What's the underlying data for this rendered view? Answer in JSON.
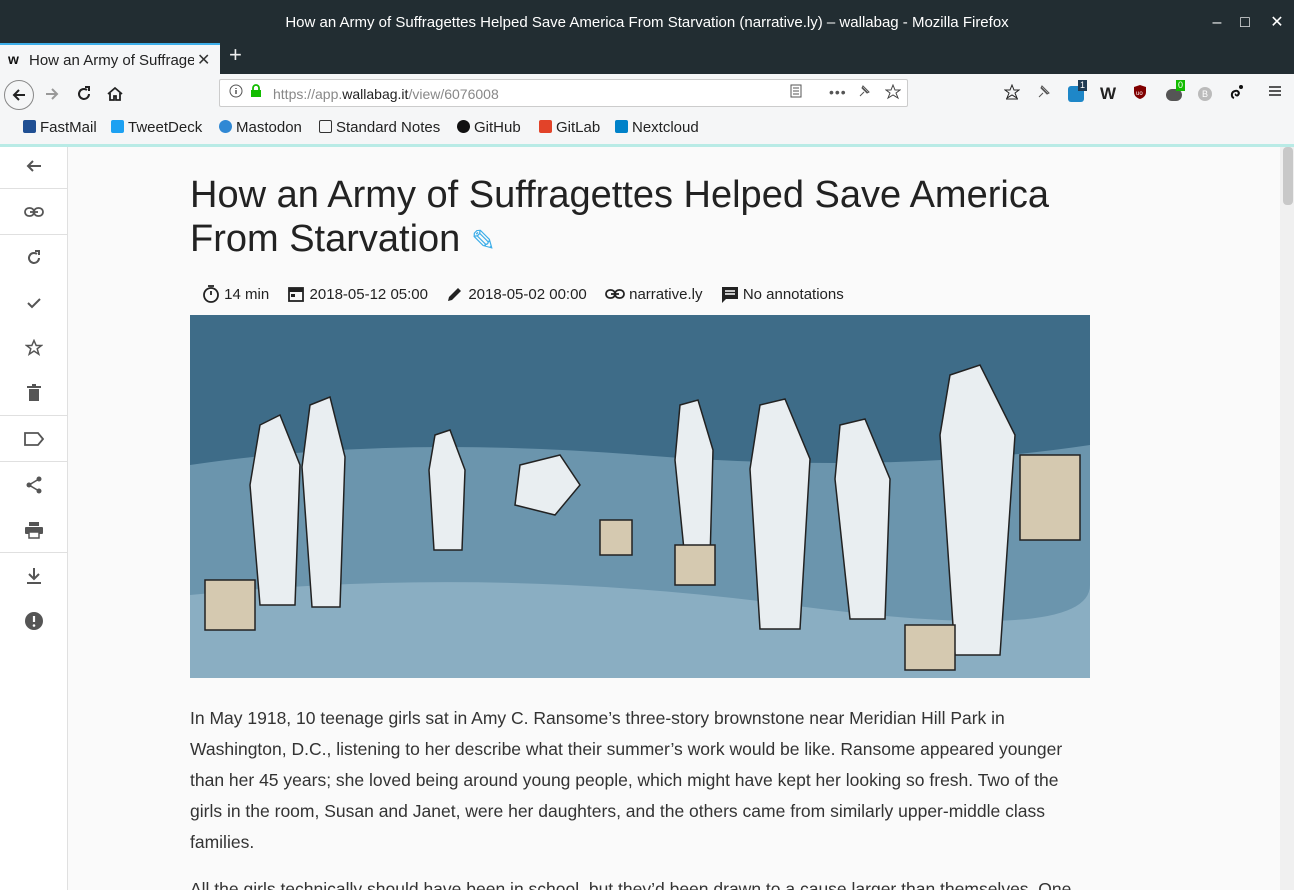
{
  "window": {
    "title": "How an Army of Suffragettes Helped Save America From Starvation (narrative.ly) – wallabag - Mozilla Firefox",
    "minimize": "–",
    "maximize": "□",
    "close": "✕"
  },
  "tab": {
    "favicon": "w",
    "title": "How an Army of Suffragettes Helped Save America From Starvation",
    "close": "✕",
    "new_tab": "+"
  },
  "nav": {
    "url_prefix": "https://app.",
    "url_domain": "wallabag.it",
    "url_path": "/view/6076008",
    "badge_count_1": "1",
    "badge_count_2": "0"
  },
  "bookmarks": [
    {
      "label": "FastMail",
      "color": "#1f4f93"
    },
    {
      "label": "TweetDeck",
      "color": "#1da1f2"
    },
    {
      "label": "Mastodon",
      "color": "#3088d4"
    },
    {
      "label": "Standard Notes",
      "color": "#333333"
    },
    {
      "label": "GitHub",
      "color": "#111111"
    },
    {
      "label": "GitLab",
      "color": "#e24329"
    },
    {
      "label": "Nextcloud",
      "color": "#0082c9"
    }
  ],
  "sidebar": [
    {
      "icon": "back-arrow-icon",
      "glyph": "←"
    },
    {
      "icon": "link-icon",
      "glyph": "⚭"
    },
    {
      "icon": "refresh-icon",
      "glyph": "↻"
    },
    {
      "icon": "check-icon",
      "glyph": "✓"
    },
    {
      "icon": "star-icon",
      "glyph": "☆"
    },
    {
      "icon": "trash-icon",
      "glyph": "■"
    },
    {
      "icon": "tag-icon",
      "glyph": "▷"
    },
    {
      "icon": "share-icon",
      "glyph": "<"
    },
    {
      "icon": "print-icon",
      "glyph": "⎙"
    },
    {
      "icon": "download-icon",
      "glyph": "⤓"
    },
    {
      "icon": "report-icon",
      "glyph": "!"
    }
  ],
  "article": {
    "title": "How an Army of Suffragettes Helped Save America From Starvation",
    "edit_glyph": "✎",
    "reading_time": "14 min",
    "created": "2018-05-12 05:00",
    "published": "2018-05-02 00:00",
    "domain": "narrative.ly",
    "annotations": "No annotations",
    "paragraphs": [
      "In May 1918, 10 teenage girls sat in Amy C. Ransome’s three-story brownstone near Meridian Hill Park in Washington, D.C., listening to her describe what their summer’s work would be like. Ransome appeared younger than her 45 years; she loved being around young people, which might have kept her looking so fresh. Two of the girls in the room, Susan and Janet, were her daughters, and the others came from similarly upper-middle class families.",
      "All the girls technically should have been in school, but they’d been drawn to a cause larger than themselves. One"
    ]
  }
}
